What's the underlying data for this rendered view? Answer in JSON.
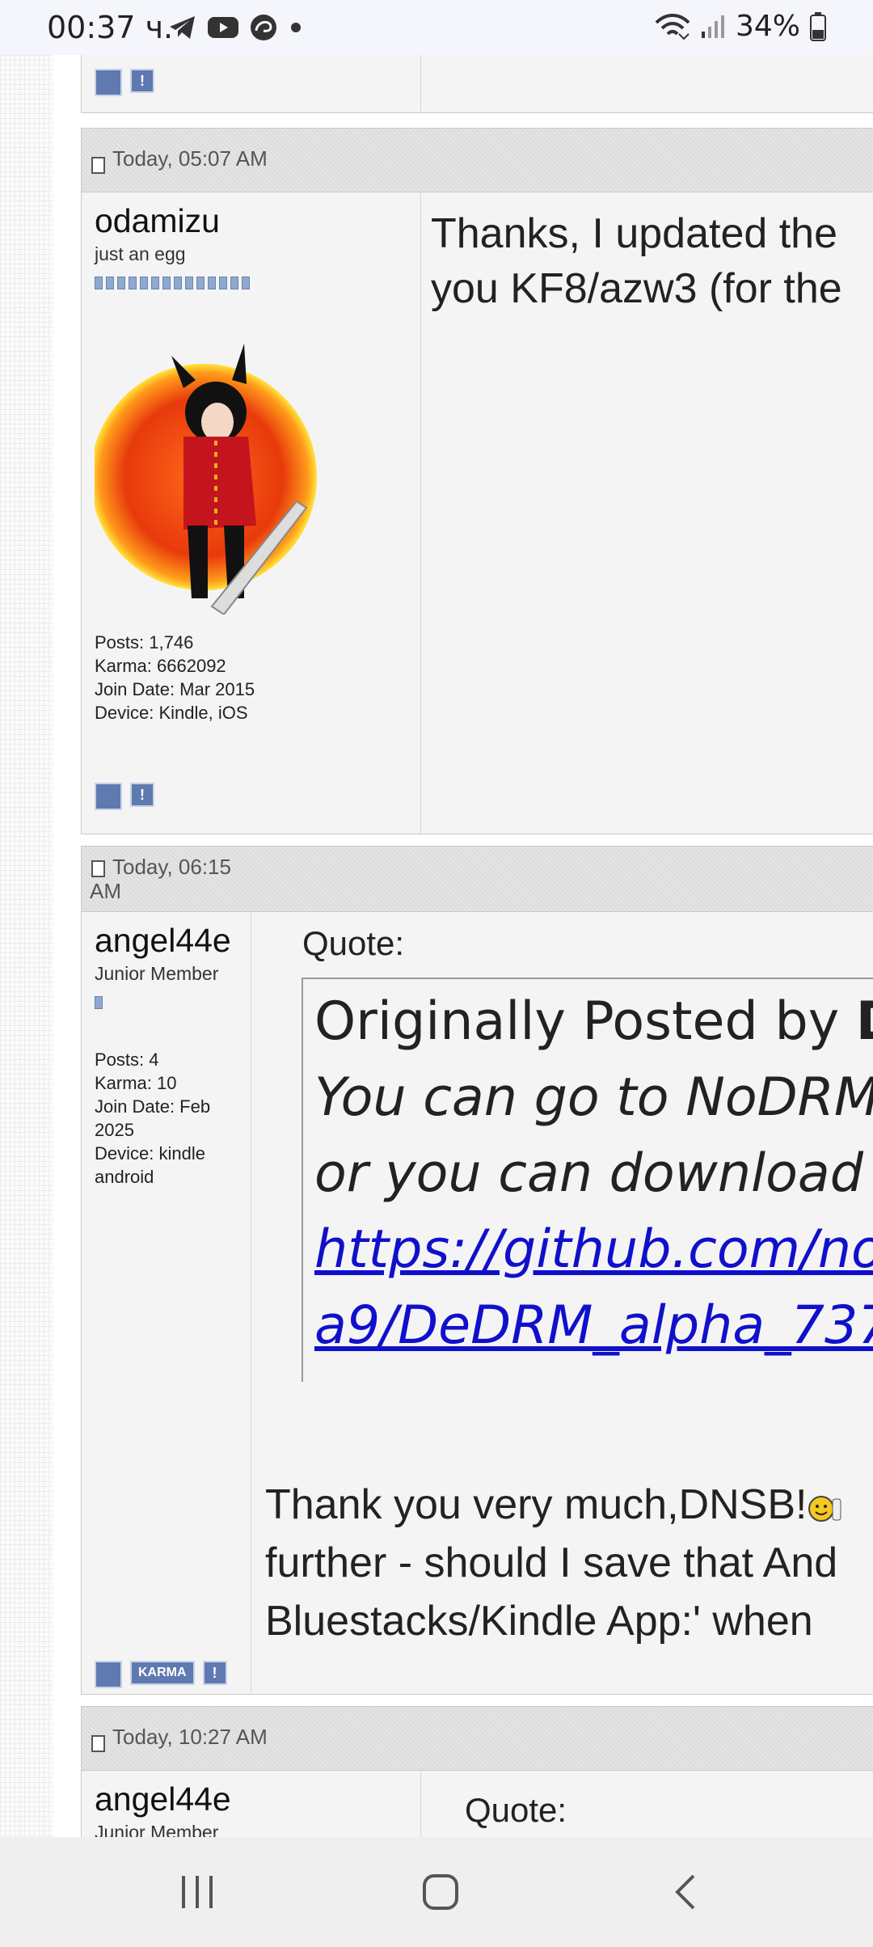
{
  "status_bar": {
    "time": "00:37 ч.",
    "battery": "34%",
    "icons": [
      "telegram-icon",
      "youtube-icon",
      "app-icon",
      "dot-icon",
      "wifi-icon",
      "signal-icon",
      "battery-icon"
    ]
  },
  "posts": [
    {
      "user_footer_icons": [
        "profile-icon",
        "report-icon"
      ]
    },
    {
      "date": "Today, 05:07 AM",
      "username": "odamizu",
      "user_title": "just an egg",
      "posts": "Posts: 1,746",
      "karma": "Karma: 6662092",
      "join_date": "Join Date: Mar 2015",
      "device": "Device: Kindle, iOS",
      "message_lines": [
        "Thanks, I updated the",
        "you KF8/azw3 (for the"
      ]
    },
    {
      "date_line1": "Today, 06:15",
      "date_line2": "AM",
      "username": "angel44e",
      "user_title": "Junior Member",
      "posts": "Posts: 4",
      "karma": "Karma: 10",
      "join_date_1": "Join Date: Feb",
      "join_date_2": "2025",
      "device_1": "Device: kindle",
      "device_2": "android",
      "karma_button": "KARMA",
      "quote_label": "Quote:",
      "quote_author_prefix": "Originally Posted by ",
      "quote_author": "D",
      "quote_line1": "You can go to NoDRM",
      "quote_line2": "or you can download t",
      "quote_link1": "https://github.com/no",
      "quote_link2": "a9/DeDRM_alpha_737",
      "message_line1": "Thank you very much,DNSB!",
      "message_line2": "further - should I save that And",
      "message_line3": "Bluestacks/Kindle App:' when"
    },
    {
      "date": "Today, 10:27 AM",
      "username": "angel44e",
      "user_title": "Junior Member",
      "quote_label": "Quote:"
    }
  ],
  "nav": {
    "recents": "recent-apps",
    "home": "home",
    "back": "back"
  },
  "colors": {
    "link": "#1010cc",
    "accent_icon": "#5f7ab0",
    "header_bg": "#dcdcdc"
  }
}
